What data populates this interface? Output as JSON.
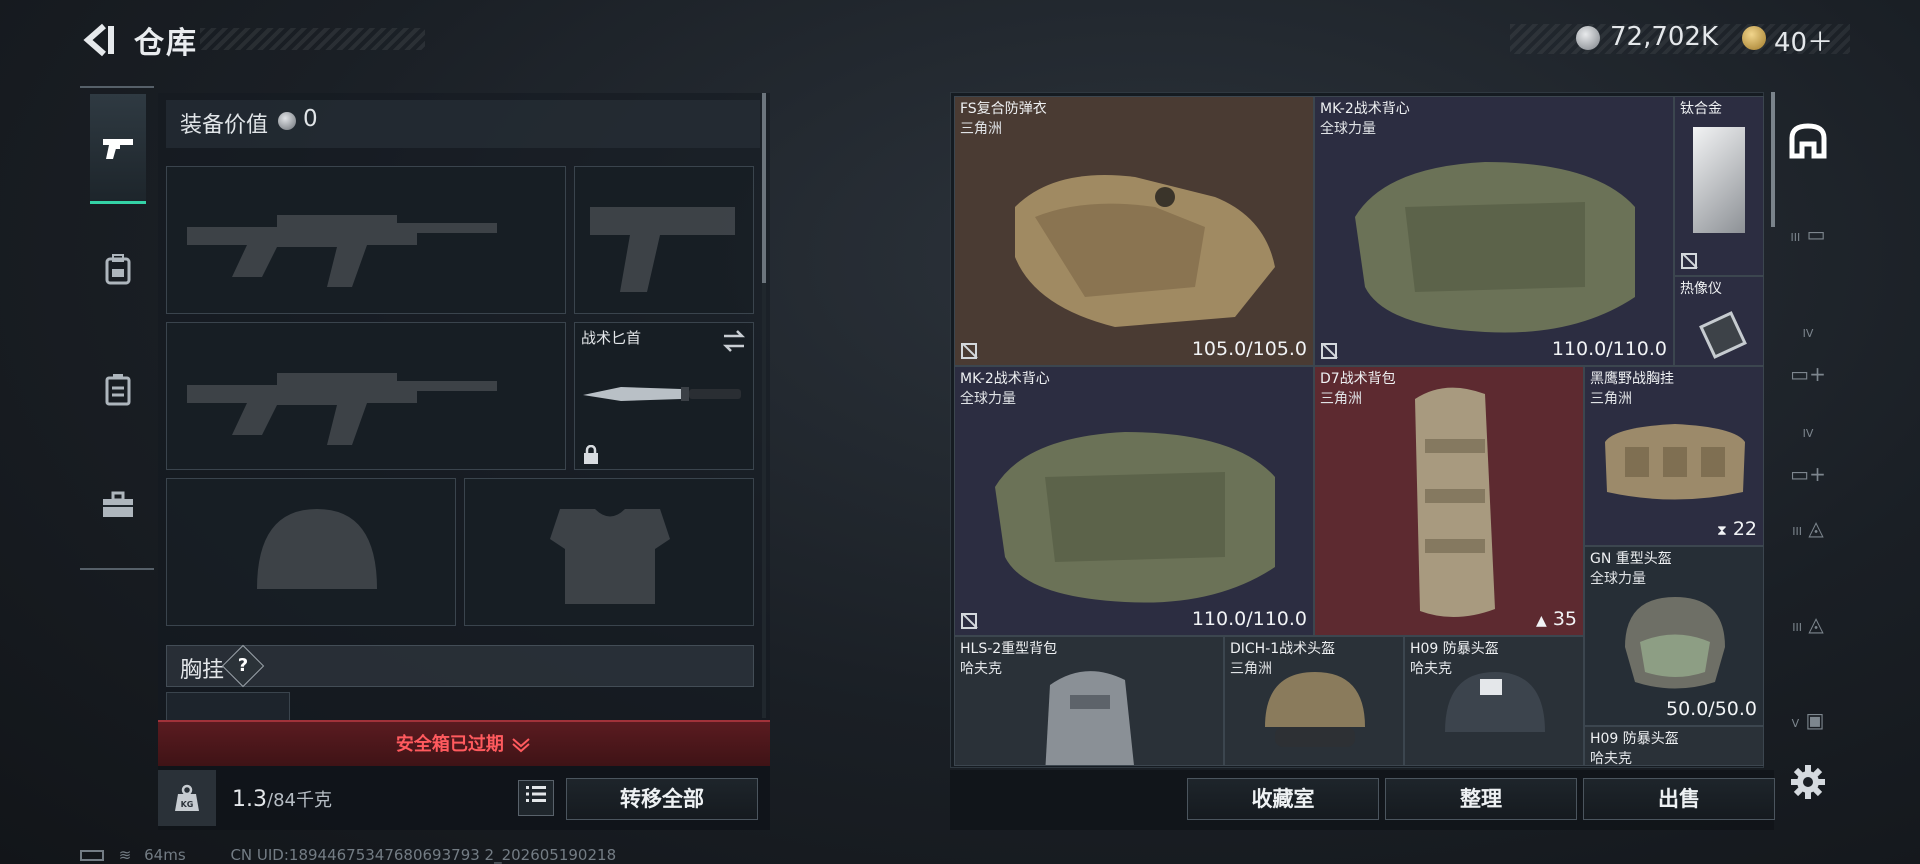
{
  "header": {
    "back_icon": "chevron-left-icon",
    "title": "仓库",
    "currency_silver": "72,702K",
    "currency_gold": "40＋"
  },
  "left_tabs": [
    {
      "name": "weapons",
      "icon": "pistol-icon",
      "active": true
    },
    {
      "name": "backpack",
      "icon": "backpack-icon",
      "active": false
    },
    {
      "name": "vest",
      "icon": "vest-icon",
      "active": false
    },
    {
      "name": "case",
      "icon": "briefcase-icon",
      "active": false
    }
  ],
  "loadout": {
    "equip_value_label": "装备价值",
    "equip_value": "0",
    "melee_label": "战术匕首",
    "chest_rig_label": "胸挂",
    "help": "?",
    "safe_box_expired": "安全箱已过期",
    "weight_current": "1.3",
    "weight_max": "/84千克",
    "transfer_all": "转移全部"
  },
  "stash": {
    "items": [
      {
        "name": "FS复合防弹衣",
        "sub": "三角洲",
        "value": "105.0/105.0",
        "durability": 1.0
      },
      {
        "name": "MK-2战术背心",
        "sub": "全球力量",
        "value": "110.0/110.0",
        "durability": 1.0
      },
      {
        "name": "钛合金",
        "sub": "",
        "value": ""
      },
      {
        "name": "热像仪",
        "sub": "",
        "value": ""
      },
      {
        "name": "MK-2战术背心",
        "sub": "全球力量",
        "value": "110.0/110.0",
        "durability": 1.0
      },
      {
        "name": "D7战术背包",
        "sub": "三角洲",
        "value": "35"
      },
      {
        "name": "黑鹰野战胸挂",
        "sub": "三角洲",
        "value": "22"
      },
      {
        "name": "GN 重型头盔",
        "sub": "全球力量",
        "value": "50.0/50.0",
        "durability": 1.0
      },
      {
        "name": "HLS-2重型背包",
        "sub": "哈夫克",
        "value": ""
      },
      {
        "name": "DICH-1战术头盔",
        "sub": "三角洲",
        "value": ""
      },
      {
        "name": "H09 防暴头盔",
        "sub": "哈夫克",
        "value": ""
      },
      {
        "name": "H09 防暴头盔",
        "sub": "哈夫克",
        "value": ""
      }
    ],
    "buttons": {
      "collection": "收藏室",
      "sort": "整理",
      "sell": "出售"
    }
  },
  "right_tools": [
    {
      "label": "",
      "icon": "stash-home-icon",
      "active": true
    },
    {
      "label": "III",
      "icon": "gun-case-icon"
    },
    {
      "label": "IV",
      "icon": "medical-case-icon"
    },
    {
      "label": "IV",
      "icon": "medical-case-icon"
    },
    {
      "label": "III",
      "icon": "ammo-case-icon"
    },
    {
      "label": "III",
      "icon": "ammo-case-icon"
    },
    {
      "label": "V",
      "icon": "card-case-icon"
    },
    {
      "label": "",
      "icon": "gear-icon"
    }
  ],
  "status": {
    "ping": "64ms",
    "uid": "CN UID:18944675347680693793 2_202605190218"
  },
  "colors": {
    "accent_green": "#34d2a6",
    "warning_red": "#ff5a5e"
  }
}
